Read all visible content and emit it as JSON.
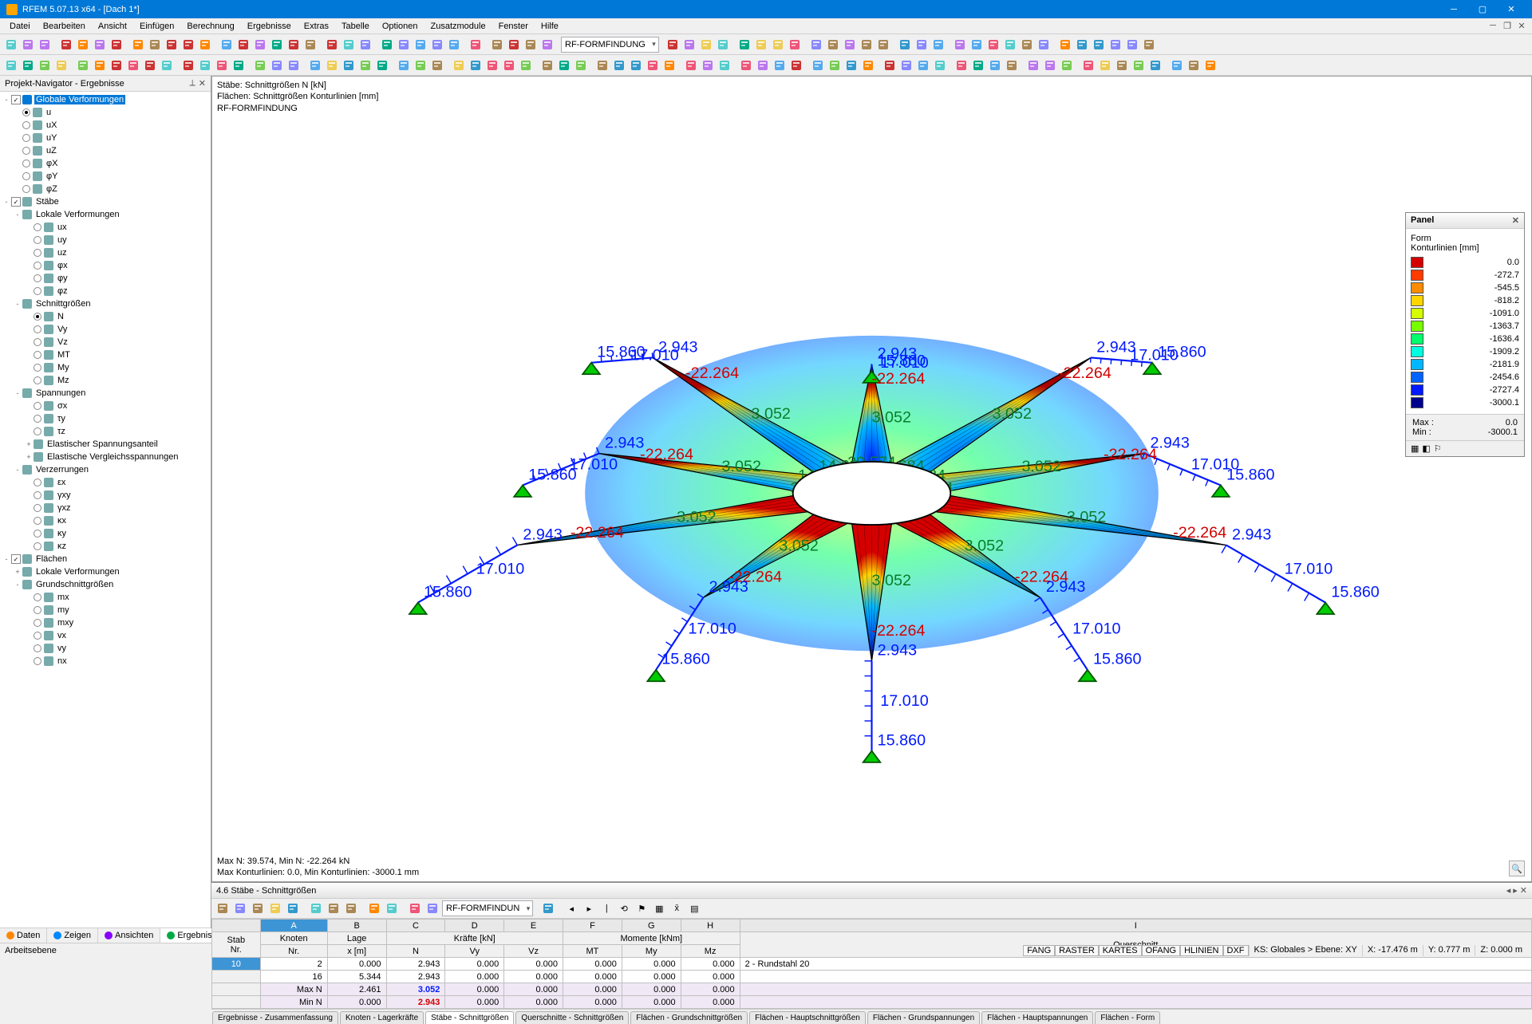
{
  "app": {
    "title": "RFEM 5.07.13 x64 - [Dach 1*]"
  },
  "menu": [
    "Datei",
    "Bearbeiten",
    "Ansicht",
    "Einfügen",
    "Berechnung",
    "Ergebnisse",
    "Extras",
    "Tabelle",
    "Optionen",
    "Zusatzmodule",
    "Fenster",
    "Hilfe"
  ],
  "toolbar_combo1": "RF-FORMFINDUNG",
  "nav": {
    "title": "Projekt-Navigator - Ergebnisse",
    "tree": [
      {
        "lvl": 0,
        "exp": "-",
        "chk": true,
        "ico": "cube-blue",
        "label": "Globale Verformungen",
        "sel": true
      },
      {
        "lvl": 1,
        "radio": "on",
        "ico": "disp",
        "label": "u"
      },
      {
        "lvl": 1,
        "radio": "off",
        "ico": "disp",
        "label": "uX"
      },
      {
        "lvl": 1,
        "radio": "off",
        "ico": "disp",
        "label": "uY"
      },
      {
        "lvl": 1,
        "radio": "off",
        "ico": "disp",
        "label": "uZ"
      },
      {
        "lvl": 1,
        "radio": "off",
        "ico": "disp",
        "label": "φX"
      },
      {
        "lvl": 1,
        "radio": "off",
        "ico": "disp",
        "label": "φY"
      },
      {
        "lvl": 1,
        "radio": "off",
        "ico": "disp",
        "label": "φZ"
      },
      {
        "lvl": 0,
        "exp": "-",
        "chk": true,
        "ico": "member",
        "label": "Stäbe"
      },
      {
        "lvl": 1,
        "exp": "-",
        "ico": "local",
        "label": "Lokale Verformungen"
      },
      {
        "lvl": 2,
        "radio": "off",
        "ico": "disp",
        "label": "ux"
      },
      {
        "lvl": 2,
        "radio": "off",
        "ico": "disp",
        "label": "uy"
      },
      {
        "lvl": 2,
        "radio": "off",
        "ico": "disp",
        "label": "uz"
      },
      {
        "lvl": 2,
        "radio": "off",
        "ico": "disp",
        "label": "φx"
      },
      {
        "lvl": 2,
        "radio": "off",
        "ico": "disp",
        "label": "φy"
      },
      {
        "lvl": 2,
        "radio": "off",
        "ico": "disp",
        "label": "φz"
      },
      {
        "lvl": 1,
        "exp": "-",
        "ico": "force",
        "label": "Schnittgrößen"
      },
      {
        "lvl": 2,
        "radio": "on",
        "ico": "N",
        "label": "N"
      },
      {
        "lvl": 2,
        "radio": "off",
        "ico": "V",
        "label": "Vy"
      },
      {
        "lvl": 2,
        "radio": "off",
        "ico": "V",
        "label": "Vz"
      },
      {
        "lvl": 2,
        "radio": "off",
        "ico": "M",
        "label": "MT"
      },
      {
        "lvl": 2,
        "radio": "off",
        "ico": "M",
        "label": "My"
      },
      {
        "lvl": 2,
        "radio": "off",
        "ico": "M",
        "label": "Mz"
      },
      {
        "lvl": 1,
        "exp": "-",
        "ico": "stress",
        "label": "Spannungen"
      },
      {
        "lvl": 2,
        "radio": "off",
        "ico": "sig",
        "label": "σx"
      },
      {
        "lvl": 2,
        "radio": "off",
        "ico": "tau",
        "label": "τy"
      },
      {
        "lvl": 2,
        "radio": "off",
        "ico": "tau",
        "label": "τz"
      },
      {
        "lvl": 2,
        "exp": "+",
        "ico": "grp",
        "label": "Elastischer Spannungsanteil"
      },
      {
        "lvl": 2,
        "exp": "+",
        "ico": "grp",
        "label": "Elastische Vergleichsspannungen"
      },
      {
        "lvl": 1,
        "exp": "-",
        "ico": "strain",
        "label": "Verzerrungen"
      },
      {
        "lvl": 2,
        "radio": "off",
        "ico": "eps",
        "label": "εx"
      },
      {
        "lvl": 2,
        "radio": "off",
        "ico": "gam",
        "label": "γxy"
      },
      {
        "lvl": 2,
        "radio": "off",
        "ico": "gam",
        "label": "γxz"
      },
      {
        "lvl": 2,
        "radio": "off",
        "ico": "kap",
        "label": "κx"
      },
      {
        "lvl": 2,
        "radio": "off",
        "ico": "kap",
        "label": "κy"
      },
      {
        "lvl": 2,
        "radio": "off",
        "ico": "kap",
        "label": "κz"
      },
      {
        "lvl": 0,
        "exp": "-",
        "chk": true,
        "ico": "surface",
        "label": "Flächen"
      },
      {
        "lvl": 1,
        "exp": "+",
        "ico": "local",
        "label": "Lokale Verformungen"
      },
      {
        "lvl": 1,
        "exp": "-",
        "ico": "force",
        "label": "Grundschnittgrößen"
      },
      {
        "lvl": 2,
        "radio": "off",
        "ico": "m",
        "label": "mx"
      },
      {
        "lvl": 2,
        "radio": "off",
        "ico": "m",
        "label": "my"
      },
      {
        "lvl": 2,
        "radio": "off",
        "ico": "m",
        "label": "mxy"
      },
      {
        "lvl": 2,
        "radio": "off",
        "ico": "v",
        "label": "vx"
      },
      {
        "lvl": 2,
        "radio": "off",
        "ico": "v",
        "label": "vy"
      },
      {
        "lvl": 2,
        "radio": "off",
        "ico": "n",
        "label": "nx"
      }
    ],
    "tabs": [
      {
        "label": "Daten",
        "color": "#ff8800"
      },
      {
        "label": "Zeigen",
        "color": "#0088ff"
      },
      {
        "label": "Ansichten",
        "color": "#8800ff"
      },
      {
        "label": "Ergebnisse",
        "color": "#00aa44",
        "active": true
      }
    ]
  },
  "viewport": {
    "info": [
      "Stäbe: Schnittgrößen N [kN]",
      "Flächen: Schnittgrößen Konturlinien [mm]",
      "RF-FORMFINDUNG"
    ],
    "info2": [
      "Max N: 39.574, Min N: -22.264 kN",
      "Max Konturlinien: 0.0, Min Konturlinien: -3000.1 mm"
    ],
    "labels": {
      "red": "-22.264",
      "blue1": "2.943",
      "blue2": "15.860",
      "blue3": "17.010",
      "green1": "3.052",
      "green2": "39.574",
      "green3": "14.684"
    }
  },
  "panel": {
    "title": "Panel",
    "sub1": "Form",
    "sub2": "Konturlinien [mm]",
    "legend": [
      {
        "c": "#d40000",
        "v": "0.0"
      },
      {
        "c": "#ff3b00",
        "v": "-272.7"
      },
      {
        "c": "#ff8c00",
        "v": "-545.5"
      },
      {
        "c": "#ffd500",
        "v": "-818.2"
      },
      {
        "c": "#d5ff00",
        "v": "-1091.0"
      },
      {
        "c": "#77ff00",
        "v": "-1363.7"
      },
      {
        "c": "#00ff6a",
        "v": "-1636.4"
      },
      {
        "c": "#00ffe0",
        "v": "-1909.2"
      },
      {
        "c": "#00b6ff",
        "v": "-2181.9"
      },
      {
        "c": "#0062ff",
        "v": "-2454.6"
      },
      {
        "c": "#0018ff",
        "v": "-2727.4"
      },
      {
        "c": "#00008b",
        "v": "-3000.1"
      }
    ],
    "max_label": "Max  :",
    "max_val": "0.0",
    "min_label": "Min  :",
    "min_val": "-3000.1"
  },
  "bottom": {
    "title": "4.6 Stäbe - Schnittgrößen",
    "combo": "RF-FORMFINDUN",
    "cols_top": [
      "",
      "A",
      "B",
      "C",
      "D",
      "E",
      "F",
      "G",
      "H",
      "I"
    ],
    "head1": {
      "stab": "Stab",
      "knoten": "Knoten",
      "lage": "Lage",
      "kraefte": "Kräfte [kN]",
      "momente": "Momente [kNm]",
      "qs": ""
    },
    "head2": {
      "nr": "Nr.",
      "knr": "Nr.",
      "xm": "x [m]",
      "N": "N",
      "Vy": "Vy",
      "Vz": "Vz",
      "MT": "MT",
      "My": "My",
      "Mz": "Mz",
      "qs": "Querschnitt"
    },
    "rows": [
      {
        "stab": "10",
        "kn": "2",
        "x": "0.000",
        "N": "2.943",
        "Vy": "0.000",
        "Vz": "0.000",
        "MT": "0.000",
        "My": "0.000",
        "Mz": "0.000",
        "qs": "2 - Rundstahl 20",
        "sel": true
      },
      {
        "stab": "",
        "kn": "16",
        "x": "5.344",
        "N": "2.943",
        "Vy": "0.000",
        "Vz": "0.000",
        "MT": "0.000",
        "My": "0.000",
        "Mz": "0.000",
        "qs": ""
      },
      {
        "stab": "",
        "kn": "Max N",
        "x": "2.461",
        "N": "3.052",
        "Vy": "0.000",
        "Vz": "0.000",
        "MT": "0.000",
        "My": "0.000",
        "Mz": "0.000",
        "qs": "",
        "cls": "maxrow",
        "ncolor": "#0018ff"
      },
      {
        "stab": "",
        "kn": "Min N",
        "x": "0.000",
        "N": "2.943",
        "Vy": "0.000",
        "Vz": "0.000",
        "MT": "0.000",
        "My": "0.000",
        "Mz": "0.000",
        "qs": "",
        "cls": "minrow",
        "ncolor": "#d40000"
      }
    ],
    "tabs": [
      "Ergebnisse - Zusammenfassung",
      "Knoten - Lagerkräfte",
      "Stäbe - Schnittgrößen",
      "Querschnitte - Schnittgrößen",
      "Flächen - Grundschnittgrößen",
      "Flächen - Hauptschnittgrößen",
      "Flächen - Grundspannungen",
      "Flächen - Hauptspannungen",
      "Flächen - Form"
    ],
    "active_tab": 2
  },
  "status": {
    "left": "Arbeitsebene",
    "buttons": [
      "FANG",
      "RASTER",
      "KARTES",
      "OFANG",
      "HLINIEN",
      "DXF"
    ],
    "cs": "KS: Globales > Ebene: XY",
    "x": "X: -17.476 m",
    "y": "Y: 0.777 m",
    "z": "Z: 0.000 m"
  },
  "chart_data": {
    "type": "heatmap",
    "title": "Flächen: Schnittgrößen Konturlinien [mm] / Stäbe: Schnittgrößen N [kN]",
    "colorbar": {
      "label": "Konturlinien [mm]",
      "min": -3000.1,
      "max": 0.0,
      "ticks": [
        0.0,
        -272.7,
        -545.5,
        -818.2,
        -1091.0,
        -1363.7,
        -1636.4,
        -1909.2,
        -2181.9,
        -2454.6,
        -2727.4,
        -3000.1
      ]
    },
    "member_N": {
      "unit": "kN",
      "max": 39.574,
      "min": -22.264,
      "sample_values": [
        2.943,
        3.052,
        15.86,
        17.01,
        39.574,
        14.684,
        -22.264
      ]
    }
  }
}
